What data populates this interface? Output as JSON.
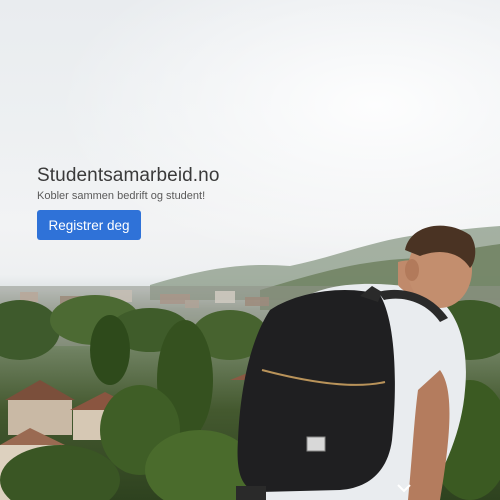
{
  "brand": {
    "title": "Studentsamarbeid.no",
    "tagline": "Kobler sammen bedrift og student!"
  },
  "cta": {
    "label": "Registrer deg",
    "color": "#2f72d8"
  },
  "scroll": {
    "icon": "chevron-down-icon"
  }
}
